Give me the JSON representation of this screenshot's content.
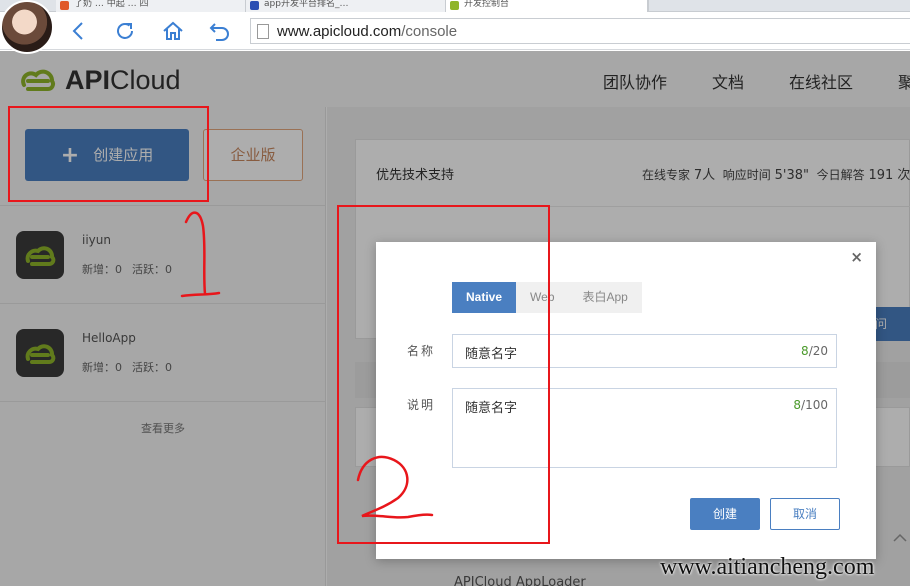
{
  "browser": {
    "tabs": [
      {
        "label": "了奶 … 中起 … 四",
        "fav_color": "#e05a2a"
      },
      {
        "label": "app开发平台排名_…",
        "fav_color": "#2b4fb3"
      },
      {
        "label": "开发控制台",
        "fav_color": "#8fb52a"
      }
    ],
    "url_host": "www.apicloud.com",
    "url_path": "/console"
  },
  "header": {
    "logo_text_bold": "API",
    "logo_text_rest": "Cloud",
    "nav": [
      "团队协作",
      "文档",
      "在线社区",
      "聚"
    ]
  },
  "sidebar": {
    "create_button": "创建应用",
    "create_icon": "plus-icon",
    "enterprise_button": "企业版",
    "apps": [
      {
        "name": "iiyun",
        "new_label": "新增：0",
        "active_label": "活跃：0"
      },
      {
        "name": "HelloApp",
        "new_label": "新增：0",
        "active_label": "活跃：0"
      }
    ],
    "see_more": "查看更多"
  },
  "main": {
    "support_title": "优先技术支持",
    "experts_label": "在线专家",
    "experts_value": "7人",
    "response_label": "响应时间",
    "response_value": "5'38\"",
    "answered_label": "今日解答",
    "answered_value": "191 次",
    "partial_button": "问",
    "loader_text": "APICloud AppLoader"
  },
  "modal": {
    "close": "×",
    "types": [
      "Native",
      "Web",
      "表白App"
    ],
    "selected_type": "Native",
    "name_label": "名称",
    "name_value": "随意名字",
    "name_count": "8",
    "name_max": "/20",
    "desc_label": "说明",
    "desc_value": "随意名字",
    "desc_count": "8",
    "desc_max": "/100",
    "create_button": "创建",
    "cancel_button": "取消"
  },
  "watermark": "www.aitiancheng.com",
  "colors": {
    "primary": "#4a7fc1",
    "enterprise": "#e3a77e",
    "annotation": "#e8161b",
    "count_ok": "#4a9a2a"
  }
}
